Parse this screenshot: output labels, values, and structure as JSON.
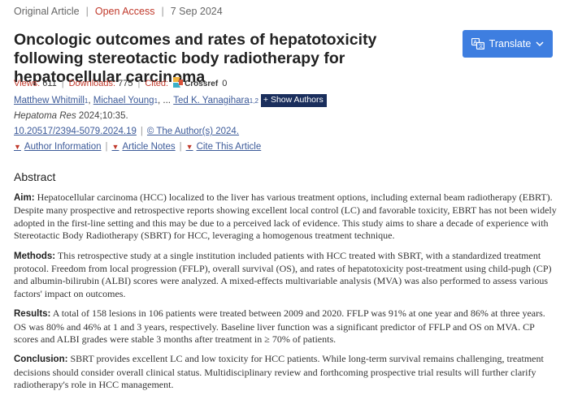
{
  "meta": {
    "article_type": "Original Article",
    "access": "Open Access",
    "date": "7 Sep 2024"
  },
  "title": "Oncologic outcomes and rates of hepatotoxicity following stereotactic body radiotherapy for hepatocellular carcinoma",
  "translate": {
    "label": "Translate",
    "icon": "translate-icon",
    "color": "#3e7ee0"
  },
  "stats": {
    "views_label": "Views:",
    "views": "611",
    "downloads_label": "Downloads:",
    "downloads": "775",
    "cited_label": "Cited:",
    "crossref_label": "Crossref",
    "cited": "0"
  },
  "authors": [
    {
      "name": "Matthew Whitmill",
      "sup": "1"
    },
    {
      "name": "Michael Young",
      "sup": "1"
    },
    {
      "name": "Ted K. Yanagihara",
      "sup": "1,2"
    }
  ],
  "authors_sep1": ",",
  "authors_sep2": ", ...",
  "show_authors_label": "+ Show Authors",
  "journal": {
    "name": "Hepatoma Res",
    "citation": "2024;10:35."
  },
  "doi": "10.20517/2394-5079.2024.19",
  "license": "© The Author(s) 2024.",
  "info_links": [
    "Author Information",
    "Article Notes",
    "Cite This Article"
  ],
  "abstract": {
    "heading": "Abstract",
    "sections": [
      {
        "label": "Aim:",
        "text": "Hepatocellular carcinoma (HCC) localized to the liver has various treatment options, including external beam radiotherapy (EBRT). Despite many prospective and retrospective reports showing excellent local control (LC) and favorable toxicity, EBRT has not been widely adopted in the first-line setting and this may be due to a perceived lack of evidence. This study aims to share a decade of experience with Stereotactic Body Radiotherapy (SBRT) for HCC, leveraging a homogenous treatment technique."
      },
      {
        "label": "Methods:",
        "text": "This retrospective study at a single institution included patients with HCC treated with SBRT, with a standardized treatment protocol. Freedom from local progression (FFLP), overall survival (OS), and rates of hepatotoxicity post-treatment using child-pugh (CP) and albumin-bilirubin (ALBI) scores were analyzed. A mixed-effects multivariable analysis (MVA) was also performed to assess various factors' impact on outcomes."
      },
      {
        "label": "Results:",
        "text": "A total of 158 lesions in 106 patients were treated between 2009 and 2020. FFLP was 91% at one year and 86% at three years. OS was 80% and 46% at 1 and 3 years, respectively. Baseline liver function was a significant predictor of FFLP and OS on MVA. CP scores and ALBI grades were stable 3 months after treatment in ≥ 70% of patients."
      },
      {
        "label": "Conclusion:",
        "text": "SBRT provides excellent LC and low toxicity for HCC patients. While long-term survival remains challenging, treatment decisions should consider overall clinical status. Multidisciplinary review and forthcoming prospective trial results will further clarify radiotherapy's role in HCC management."
      }
    ]
  },
  "colors": {
    "accent_red": "#c0392b",
    "link_blue": "#3c5a99",
    "show_authors_bg": "#1a2e5c"
  }
}
